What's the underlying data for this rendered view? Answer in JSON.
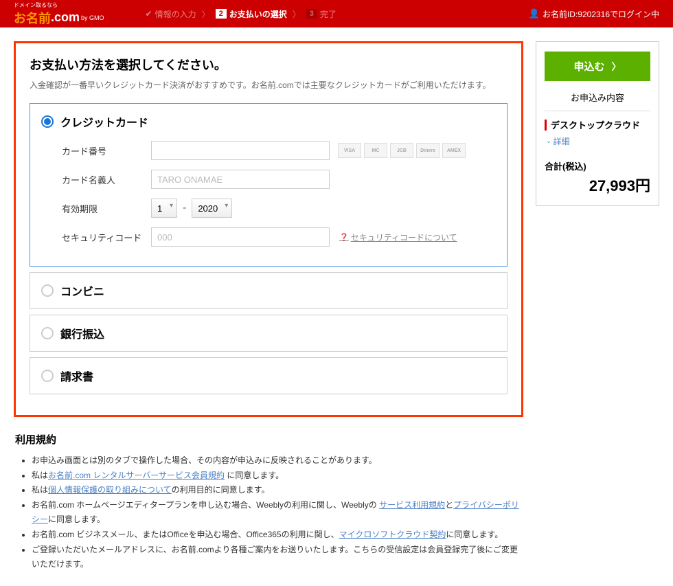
{
  "header": {
    "logo_tagline": "ドメイン取るなら",
    "logo_part1": "お名前",
    "logo_part2": ".com",
    "logo_gmo": "by GMO",
    "steps": [
      {
        "label": "情報の入力"
      },
      {
        "num": "2",
        "label": "お支払いの選択"
      },
      {
        "num": "3",
        "label": "完了"
      }
    ],
    "user_label": "お名前ID:9202316でログイン中"
  },
  "payment": {
    "title": "お支払い方法を選択してください。",
    "desc": "入金確認が一番早いクレジットカード決済がおすすめです。お名前.comでは主要なクレジットカードがご利用いただけます。",
    "options": {
      "credit": "クレジットカード",
      "conveni": "コンビニ",
      "bank": "銀行振込",
      "invoice": "請求書"
    },
    "card_form": {
      "number_label": "カード番号",
      "name_label": "カード名義人",
      "name_placeholder": "TARO ONAMAE",
      "expiry_label": "有効期限",
      "expiry_month": "1",
      "expiry_year": "2020",
      "cvv_label": "セキュリティコード",
      "cvv_placeholder": "000",
      "cvv_help": "セキュリティコードについて"
    },
    "card_brands": [
      "VISA",
      "MC",
      "JCB",
      "Diners",
      "AMEX"
    ]
  },
  "sidebar": {
    "apply_button": "申込む",
    "contents_title": "お申込み内容",
    "product_name": "デスクトップクラウド",
    "detail_link": "詳細",
    "total_label": "合計(税込)",
    "total_price": "27,993円"
  },
  "terms": {
    "title": "利用規約",
    "items": [
      {
        "prefix": "お申込み画面とは別のタブで操作した場合、その内容が申込みに反映されることがあります。"
      },
      {
        "prefix": "私は",
        "link1": "お名前.com レンタルサーバーサービス会員規約",
        "suffix1": " に同意します。"
      },
      {
        "prefix": "私は",
        "link1": "個人情報保護の取り組みについて",
        "suffix1": "の利用目的に同意します。"
      },
      {
        "prefix": "お名前.com ホームページエディタープランを申し込む場合、Weeblyの利用に関し、Weeblyの ",
        "link1": "サービス利用規約",
        "mid": "と",
        "link2": "プライバシーポリシー",
        "suffix1": "に同意します。"
      },
      {
        "prefix": "お名前.com ビジネスメール、またはOfficeを申込む場合、Office365の利用に関し、",
        "link1": "マイクロソフトクラウド契約",
        "suffix1": "に同意します。"
      },
      {
        "prefix": "ご登録いただいたメールアドレスに、お名前.comより各種ご案内をお送りいたします。こちらの受信設定は会員登録完了後にご変更いただけます。"
      }
    ]
  }
}
